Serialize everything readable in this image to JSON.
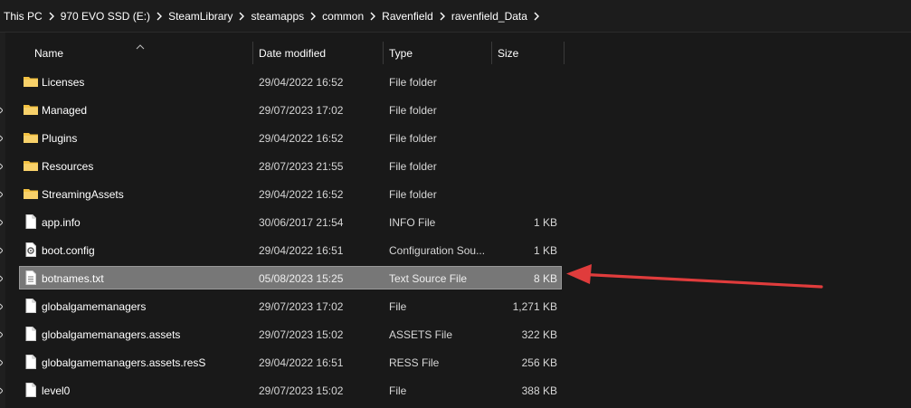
{
  "breadcrumb": [
    "This PC",
    "970 EVO SSD (E:)",
    "SteamLibrary",
    "steamapps",
    "common",
    "Ravenfield",
    "ravenfield_Data"
  ],
  "columns": {
    "name": "Name",
    "date": "Date modified",
    "type": "Type",
    "size": "Size"
  },
  "files": [
    {
      "name": "Licenses",
      "date": "29/04/2022 16:52",
      "type": "File folder",
      "size": "",
      "icon": "folder-icon"
    },
    {
      "name": "Managed",
      "date": "29/07/2023 17:02",
      "type": "File folder",
      "size": "",
      "icon": "folder-icon"
    },
    {
      "name": "Plugins",
      "date": "29/04/2022 16:52",
      "type": "File folder",
      "size": "",
      "icon": "folder-icon"
    },
    {
      "name": "Resources",
      "date": "28/07/2023 21:55",
      "type": "File folder",
      "size": "",
      "icon": "folder-icon"
    },
    {
      "name": "StreamingAssets",
      "date": "29/04/2022 16:52",
      "type": "File folder",
      "size": "",
      "icon": "folder-icon"
    },
    {
      "name": "app.info",
      "date": "30/06/2017 21:54",
      "type": "INFO File",
      "size": "1 KB",
      "icon": "file-icon"
    },
    {
      "name": "boot.config",
      "date": "29/04/2022 16:51",
      "type": "Configuration Sou...",
      "size": "1 KB",
      "icon": "config-file-icon"
    },
    {
      "name": "botnames.txt",
      "date": "05/08/2023 15:25",
      "type": "Text Source File",
      "size": "8 KB",
      "icon": "text-file-icon",
      "selected": true
    },
    {
      "name": "globalgamemanagers",
      "date": "29/07/2023 17:02",
      "type": "File",
      "size": "1,271 KB",
      "icon": "file-icon"
    },
    {
      "name": "globalgamemanagers.assets",
      "date": "29/07/2023 15:02",
      "type": "ASSETS File",
      "size": "322 KB",
      "icon": "file-icon"
    },
    {
      "name": "globalgamemanagers.assets.resS",
      "date": "29/04/2022 16:51",
      "type": "RESS File",
      "size": "256 KB",
      "icon": "file-icon"
    },
    {
      "name": "level0",
      "date": "29/07/2023 15:02",
      "type": "File",
      "size": "388 KB",
      "icon": "file-icon"
    }
  ],
  "colors": {
    "arrow": "#e03c3c",
    "folder": "#f4c242",
    "selected_row": "#777777",
    "background": "#191919"
  }
}
